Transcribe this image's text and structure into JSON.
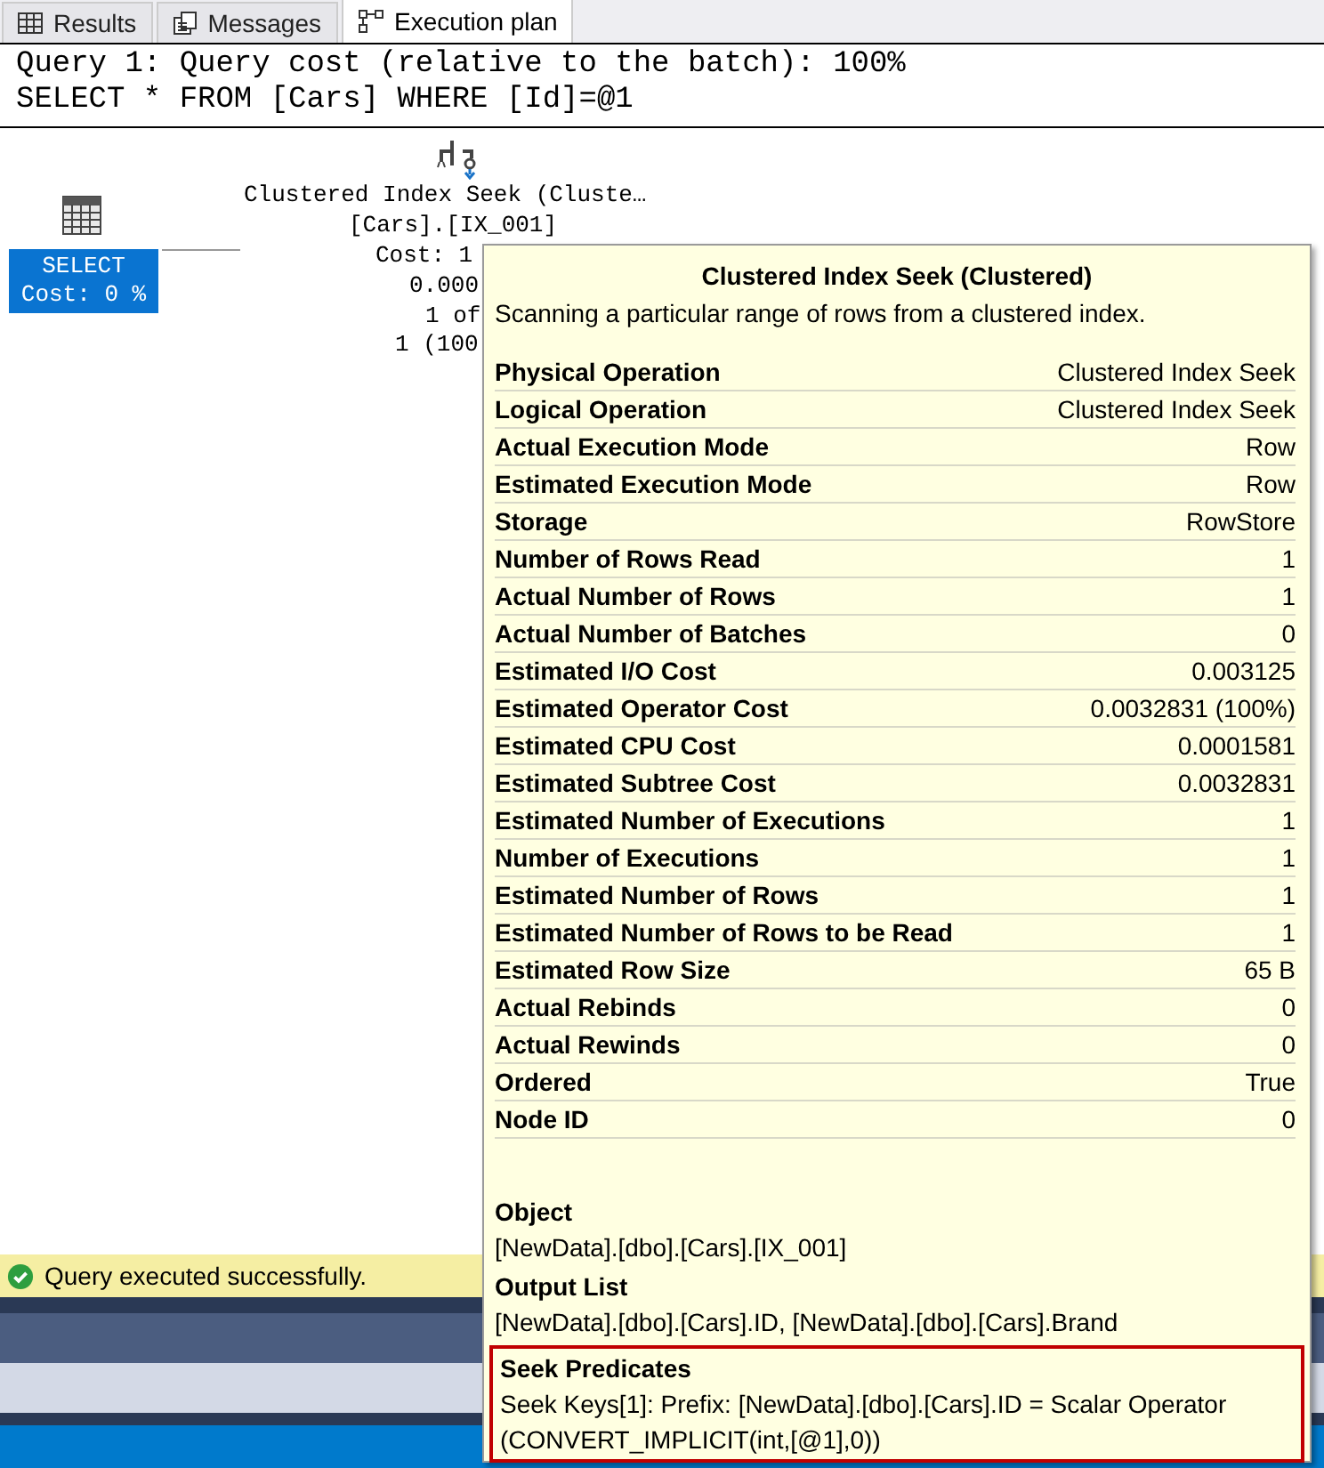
{
  "tabs": [
    {
      "label": "Results",
      "kind": "grid",
      "selected": false
    },
    {
      "label": "Messages",
      "kind": "messages",
      "selected": false
    },
    {
      "label": "Execution plan",
      "kind": "plan",
      "selected": true
    }
  ],
  "query": {
    "header": "Query 1: Query cost (relative to the batch): 100%",
    "sql": "SELECT * FROM [Cars] WHERE [Id]=@1"
  },
  "plan": {
    "nodes": [
      {
        "kind": "select",
        "selected": true,
        "lines": [
          "SELECT",
          "Cost: 0 %"
        ]
      },
      {
        "kind": "seek",
        "lines": [
          "Clustered Index Seek (Cluste…",
          "[Cars].[IX_001]",
          "Cost: 1",
          "0.000",
          "1 of",
          "1 (100"
        ]
      }
    ]
  },
  "tooltip": {
    "title": "Clustered Index Seek (Clustered)",
    "description": "Scanning a particular range of rows from a clustered index.",
    "properties": [
      {
        "name": "Physical Operation",
        "value": "Clustered Index Seek"
      },
      {
        "name": "Logical Operation",
        "value": "Clustered Index Seek"
      },
      {
        "name": "Actual Execution Mode",
        "value": "Row"
      },
      {
        "name": "Estimated Execution Mode",
        "value": "Row"
      },
      {
        "name": "Storage",
        "value": "RowStore"
      },
      {
        "name": "Number of Rows Read",
        "value": "1"
      },
      {
        "name": "Actual Number of Rows",
        "value": "1"
      },
      {
        "name": "Actual Number of Batches",
        "value": "0"
      },
      {
        "name": "Estimated I/O Cost",
        "value": "0.003125"
      },
      {
        "name": "Estimated Operator Cost",
        "value": "0.0032831 (100%)"
      },
      {
        "name": "Estimated CPU Cost",
        "value": "0.0001581"
      },
      {
        "name": "Estimated Subtree Cost",
        "value": "0.0032831"
      },
      {
        "name": "Estimated Number of Executions",
        "value": "1"
      },
      {
        "name": "Number of Executions",
        "value": "1"
      },
      {
        "name": "Estimated Number of Rows",
        "value": "1"
      },
      {
        "name": "Estimated Number of Rows to be Read",
        "value": "1"
      },
      {
        "name": "Estimated Row Size",
        "value": "65 B"
      },
      {
        "name": "Actual Rebinds",
        "value": "0"
      },
      {
        "name": "Actual Rewinds",
        "value": "0"
      },
      {
        "name": "Ordered",
        "value": "True"
      },
      {
        "name": "Node ID",
        "value": "0"
      }
    ],
    "sections": [
      {
        "heading": "Object",
        "text": "[NewData].[dbo].[Cars].[IX_001]",
        "highlighted": false
      },
      {
        "heading": "Output List",
        "text": "[NewData].[dbo].[Cars].ID, [NewData].[dbo].[Cars].Brand",
        "highlighted": false
      },
      {
        "heading": "Seek Predicates",
        "text": "Seek Keys[1]: Prefix: [NewData].[dbo].[Cars].ID = Scalar Operator (CONVERT_IMPLICIT(int,[@1],0))",
        "highlighted": true
      }
    ]
  },
  "status": {
    "text": "Query executed successfully.",
    "success": true
  }
}
